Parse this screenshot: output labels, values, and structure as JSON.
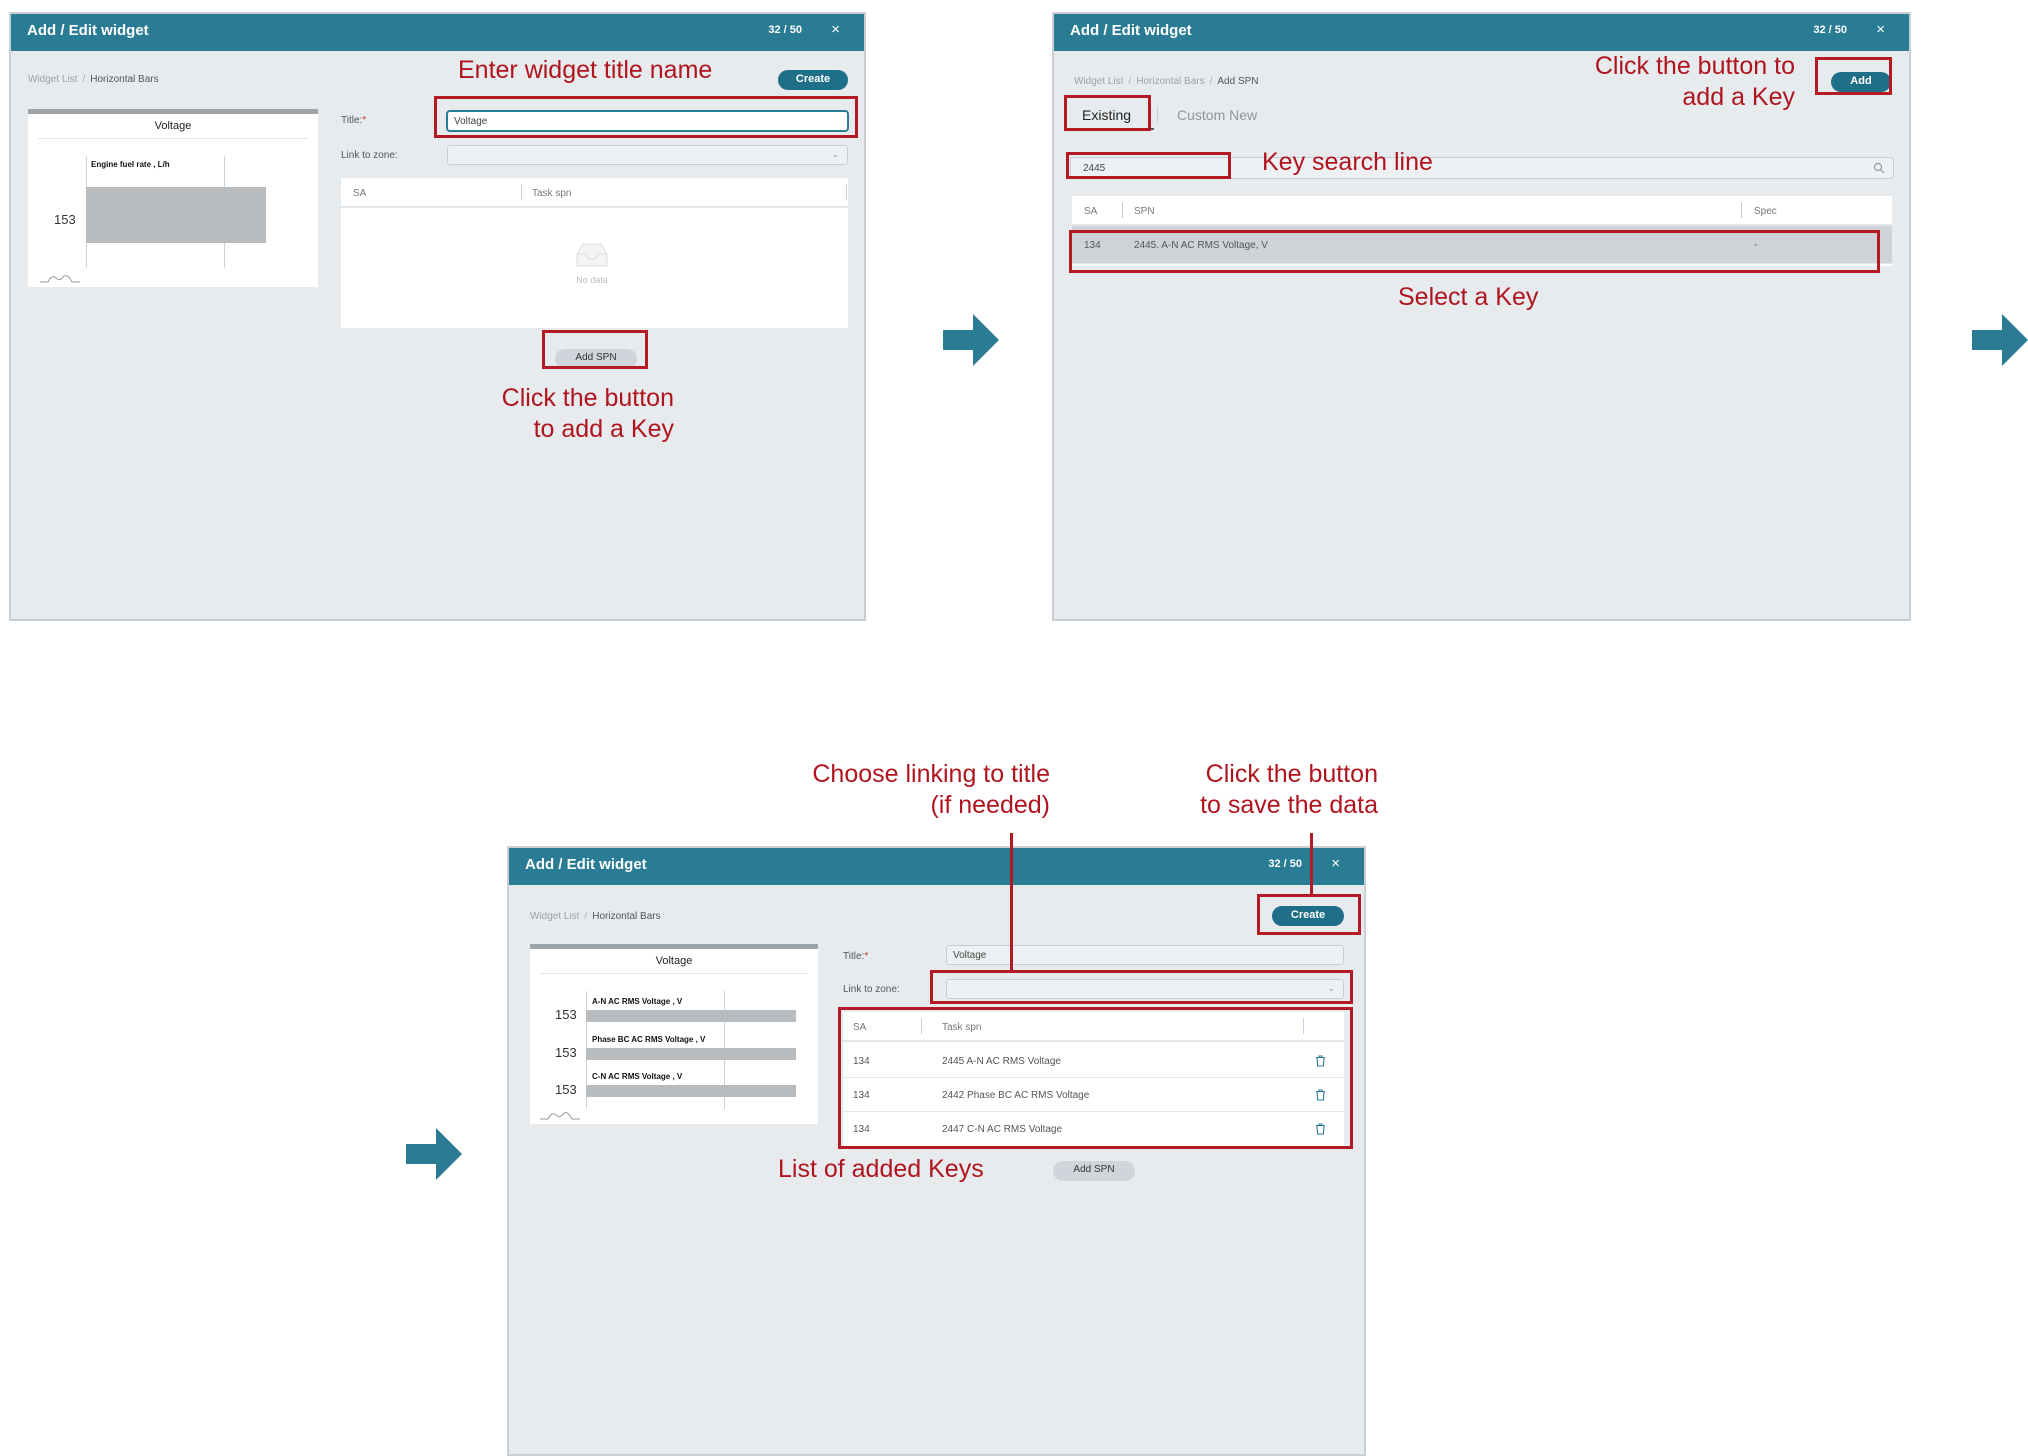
{
  "annotations": {
    "p1_title": "Enter widget title name",
    "p1_addkey": "Click the button\nto add a Key",
    "p2_add": "Click the button to\nadd a Key",
    "p2_search": "Key search line",
    "p2_select": "Select a Key",
    "p3_link": "Choose linking to title\n(if needed)",
    "p3_save": "Click the button\nto save the data",
    "p3_list": "List of added Keys"
  },
  "colors": {
    "header": "#2a7b94",
    "annotation": "#b0141e",
    "arrow": "#2a7b94"
  },
  "panel1": {
    "window_title": "Add / Edit widget",
    "count": "32 / 50",
    "close": "×",
    "breadcrumb": [
      "Widget List",
      "Horizontal Bars"
    ],
    "create_label": "Create",
    "title_label": "Title:",
    "title_required": "*",
    "title_value": "Voltage",
    "link_label": "Link to zone:",
    "col_sa": "SA",
    "col_task": "Task spn",
    "no_data": "No data",
    "add_spn": "Add SPN",
    "preview": {
      "title": "Voltage",
      "series": [
        {
          "name": "Engine fuel rate , L/h",
          "value": "153"
        }
      ]
    }
  },
  "panel2": {
    "window_title": "Add / Edit widget",
    "count": "32 / 50",
    "close": "×",
    "breadcrumb": [
      "Widget List",
      "Horizontal Bars",
      "Add SPN"
    ],
    "add_label": "Add",
    "tab_existing": "Existing",
    "tab_custom": "Custom New",
    "search_value": "2445",
    "col_sa": "SA",
    "col_spn": "SPN",
    "col_spec": "Spec",
    "rows": [
      {
        "sa": "134",
        "spn": "2445. A-N AC RMS Voltage, V",
        "spec": "-"
      }
    ]
  },
  "panel3": {
    "window_title": "Add / Edit widget",
    "count": "32 / 50",
    "close": "×",
    "breadcrumb": [
      "Widget List",
      "Horizontal Bars"
    ],
    "create_label": "Create",
    "title_label": "Title:",
    "title_required": "*",
    "title_value": "Voltage",
    "link_label": "Link to zone:",
    "col_sa": "SA",
    "col_task": "Task spn",
    "rows": [
      {
        "sa": "134",
        "task": "2445 A-N AC RMS Voltage"
      },
      {
        "sa": "134",
        "task": "2442 Phase BC AC RMS Voltage"
      },
      {
        "sa": "134",
        "task": "2447 C-N AC RMS Voltage"
      }
    ],
    "add_spn": "Add SPN",
    "preview": {
      "title": "Voltage",
      "series": [
        {
          "name": "A-N AC RMS Voltage , V",
          "value": "153"
        },
        {
          "name": "Phase BC AC RMS Voltage , V",
          "value": "153"
        },
        {
          "name": "C-N AC RMS Voltage , V",
          "value": "153"
        }
      ]
    }
  }
}
